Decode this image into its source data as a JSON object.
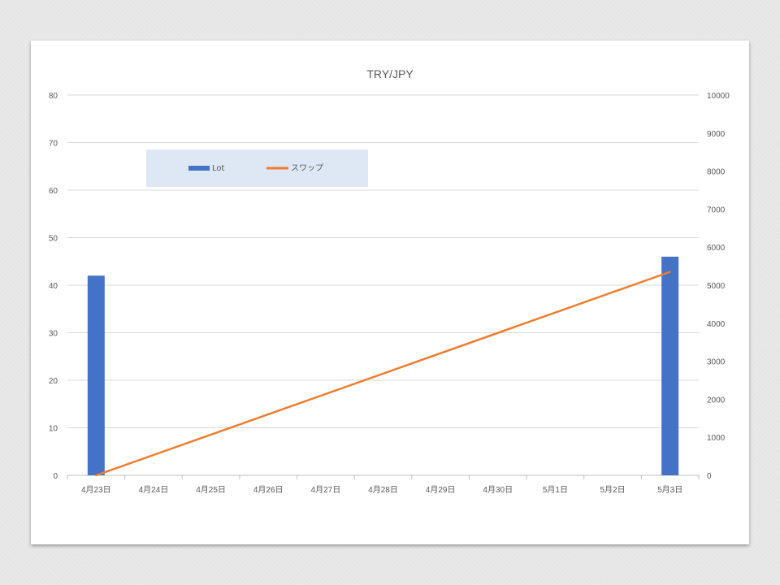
{
  "chart_data": {
    "type": "bar",
    "title": "TRY/JPY",
    "categories": [
      "4月23日",
      "4月24日",
      "4月25日",
      "4月26日",
      "4月27日",
      "4月28日",
      "4月29日",
      "4月30日",
      "5月1日",
      "5月2日",
      "5月3日"
    ],
    "series": [
      {
        "name": "Lot",
        "type": "bar",
        "axis": "left",
        "color": "#4472C4",
        "values": [
          42,
          null,
          null,
          null,
          null,
          null,
          null,
          null,
          null,
          null,
          46
        ]
      },
      {
        "name": "スワップ",
        "type": "line",
        "axis": "right",
        "color": "#ED7D31",
        "points": [
          {
            "x": "4月23日",
            "y": 0
          },
          {
            "x": "5月3日",
            "y": 5350
          }
        ]
      }
    ],
    "y_left": {
      "min": 0,
      "max": 80,
      "step": 10
    },
    "y_right": {
      "min": 0,
      "max": 10000,
      "step": 1000
    },
    "grid": true,
    "legend_position": "top-left"
  }
}
